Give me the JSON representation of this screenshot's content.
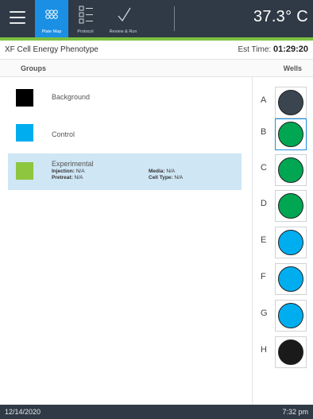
{
  "header": {
    "tabs": [
      {
        "label": "Plate Map",
        "icon": "plate-grid-icon",
        "active": true
      },
      {
        "label": "Protocol",
        "icon": "protocol-list-icon",
        "active": false
      },
      {
        "label": "Review & Run",
        "icon": "checkmark-icon",
        "active": false
      }
    ],
    "temperature": "37.3° C"
  },
  "assay": {
    "title": "XF Cell Energy Phenotype",
    "est_time_label": "Est Time:",
    "est_time_value": "01:29:20"
  },
  "columns": {
    "groups": "Groups",
    "wells": "Wells"
  },
  "groups": [
    {
      "name": "Background",
      "color": "#000000"
    },
    {
      "name": "Control",
      "color": "#00aeef"
    },
    {
      "name": "Experimental",
      "color": "#8dc63f",
      "selected": true,
      "injection_label": "Injection:",
      "injection_value": "N/A",
      "pretreat_label": "Pretreat:",
      "pretreat_value": "N/A",
      "media_label": "Media:",
      "media_value": "N/A",
      "celltype_label": "Cell Type:",
      "celltype_value": "N/A"
    }
  ],
  "wells": [
    {
      "row": "A",
      "color": "#3a4550"
    },
    {
      "row": "B",
      "color": "#00a651",
      "selected": true
    },
    {
      "row": "C",
      "color": "#00a651"
    },
    {
      "row": "D",
      "color": "#00a651"
    },
    {
      "row": "E",
      "color": "#00aeef"
    },
    {
      "row": "F",
      "color": "#00aeef"
    },
    {
      "row": "G",
      "color": "#00aeef"
    },
    {
      "row": "H",
      "color": "#1a1a1a"
    }
  ],
  "status": {
    "date": "12/14/2020",
    "time": "7:32 pm"
  },
  "colors": {
    "topbar": "#2f3a46",
    "accent_green": "#7cc142",
    "active_tab": "#1a8fe3",
    "selected_group": "#cfe6f5"
  }
}
